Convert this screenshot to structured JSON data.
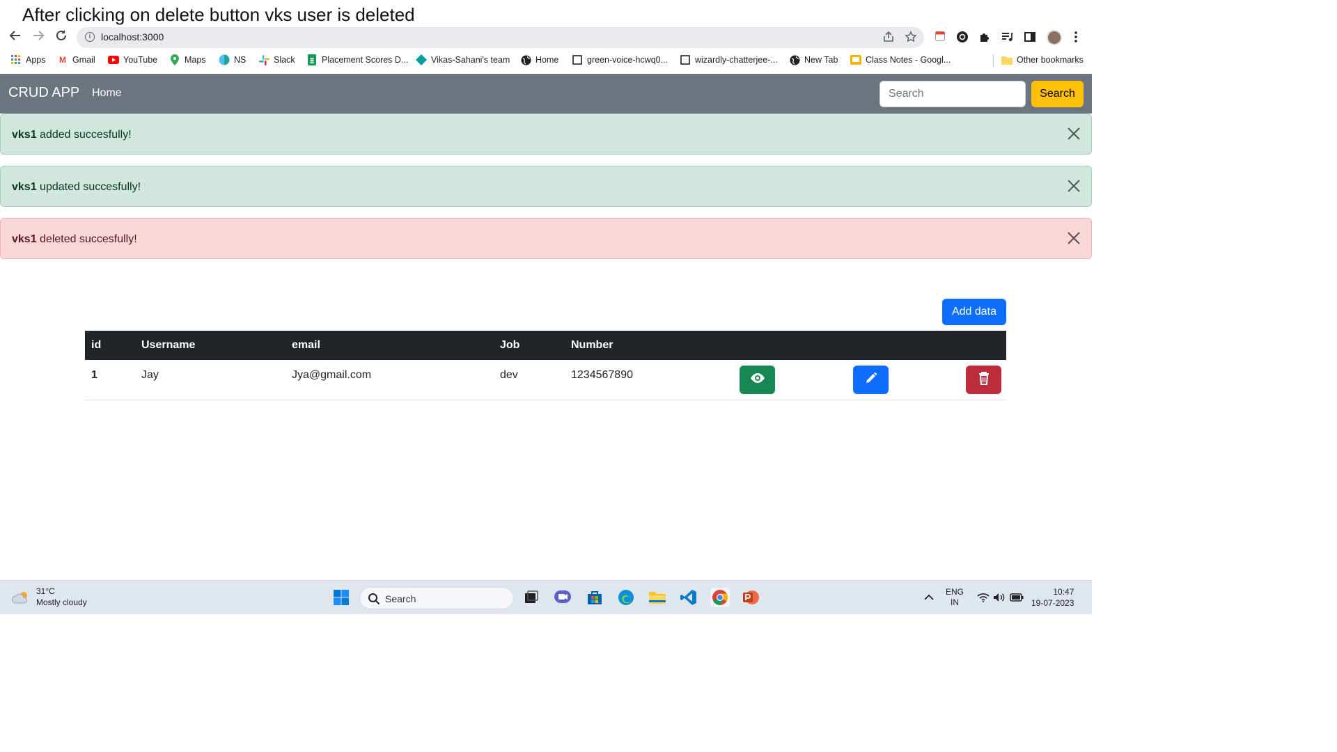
{
  "caption": "After clicking on delete button vks user is deleted",
  "browser": {
    "url": "localhost:3000",
    "bookmarks": [
      {
        "label": "Apps",
        "icon": "apps-grid-icon",
        "color": "#4285f4"
      },
      {
        "label": "Gmail",
        "icon": "gmail-icon",
        "color": "#ea4335"
      },
      {
        "label": "YouTube",
        "icon": "youtube-icon",
        "color": "#ff0000"
      },
      {
        "label": "Maps",
        "icon": "maps-pin-icon",
        "color": "#34a853"
      },
      {
        "label": "NS",
        "icon": "ns-icon",
        "color": "#4fc3f7"
      },
      {
        "label": "Slack",
        "icon": "slack-icon",
        "color": "#e01e5a"
      },
      {
        "label": "Placement Scores D...",
        "icon": "sheets-icon",
        "color": "#0f9d58"
      },
      {
        "label": "Vikas-Sahani's team",
        "icon": "diamond-icon",
        "color": "#00a0a0"
      },
      {
        "label": "Home",
        "icon": "globe-icon",
        "color": "#202124"
      },
      {
        "label": "green-voice-hcwq0...",
        "icon": "page-icon",
        "color": "#202124"
      },
      {
        "label": "wizardly-chatterjee-...",
        "icon": "page-icon",
        "color": "#202124"
      },
      {
        "label": "New Tab",
        "icon": "globe-icon",
        "color": "#202124"
      },
      {
        "label": "Class Notes - Googl...",
        "icon": "slides-icon",
        "color": "#f4b400"
      }
    ],
    "other_bookmarks": "Other bookmarks"
  },
  "navbar": {
    "brand": "CRUD APP",
    "home": "Home",
    "search_placeholder": "Search",
    "search_button": "Search"
  },
  "alerts": [
    {
      "user": "vks1",
      "message": " added succesfully!",
      "type": "success"
    },
    {
      "user": "vks1",
      "message": " updated succesfully!",
      "type": "success"
    },
    {
      "user": "vks1",
      "message": " deleted succesfully!",
      "type": "danger"
    }
  ],
  "add_data_label": "Add data",
  "table": {
    "headers": [
      "id",
      "Username",
      "email",
      "Job",
      "Number"
    ],
    "rows": [
      {
        "id": "1",
        "username": "Jay",
        "email": "Jya@gmail.com",
        "job": "dev",
        "number": "1234567890"
      }
    ]
  },
  "colors": {
    "navbar": "#6c757d",
    "view": "#198754",
    "edit": "#0d6efd",
    "delete": "#bb2d3b",
    "search_btn": "#ffc107"
  },
  "taskbar": {
    "temperature": "31°C",
    "weather": "Mostly cloudy",
    "search": "Search",
    "lang1": "ENG",
    "lang2": "IN",
    "time": "10:47",
    "date": "19-07-2023"
  }
}
